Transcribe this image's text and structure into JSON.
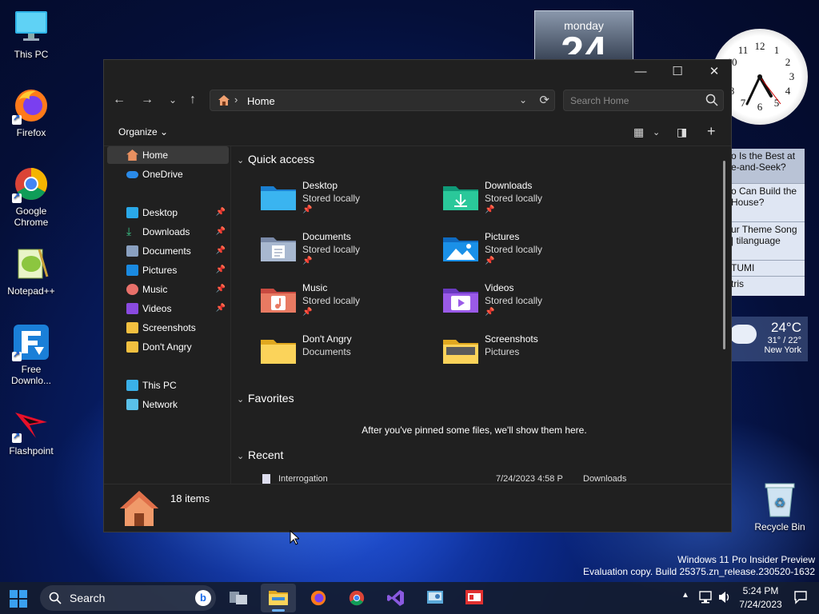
{
  "desktop": {
    "icons": [
      {
        "label": "This PC"
      },
      {
        "label": "Firefox"
      },
      {
        "label": "Google Chrome"
      },
      {
        "label": "Notepad++"
      },
      {
        "label": "Free Downlo..."
      },
      {
        "label": "Flashpoint"
      }
    ],
    "recycle_bin": "Recycle Bin",
    "watermark_line1": "Windows 11 Pro Insider Preview",
    "watermark_line2": "Evaluation copy. Build 25375.zn_release.230520-1632"
  },
  "gadgets": {
    "calendar_day": "monday",
    "calendar_num": "24",
    "rss": [
      "o Is the Best at e-and-Seek?",
      "o Can Build the House?",
      "ur Theme Song | tilanguage",
      "TUMI",
      "tris"
    ],
    "weather_temp": "24°C",
    "weather_range": "31° / 22°",
    "weather_city": "New York"
  },
  "explorer": {
    "address_path": "Home",
    "search_placeholder": "Search Home",
    "organize_label": "Organize",
    "sidebar": [
      {
        "label": "Home"
      },
      {
        "label": "OneDrive"
      },
      {
        "label": "Desktop"
      },
      {
        "label": "Downloads"
      },
      {
        "label": "Documents"
      },
      {
        "label": "Pictures"
      },
      {
        "label": "Music"
      },
      {
        "label": "Videos"
      },
      {
        "label": "Screenshots"
      },
      {
        "label": "Don't Angry"
      },
      {
        "label": "This PC"
      },
      {
        "label": "Network"
      }
    ],
    "quick_access_title": "Quick access",
    "quick_access": [
      {
        "name": "Desktop",
        "sub": "Stored locally"
      },
      {
        "name": "Downloads",
        "sub": "Stored locally"
      },
      {
        "name": "Documents",
        "sub": "Stored locally"
      },
      {
        "name": "Pictures",
        "sub": "Stored locally"
      },
      {
        "name": "Music",
        "sub": "Stored locally"
      },
      {
        "name": "Videos",
        "sub": "Stored locally"
      },
      {
        "name": "Don't Angry",
        "sub": "Documents"
      },
      {
        "name": "Screenshots",
        "sub": "Pictures"
      }
    ],
    "favorites_title": "Favorites",
    "favorites_empty": "After you've pinned some files, we'll show them here.",
    "recent_title": "Recent",
    "recent_row": {
      "name": "Interrogation",
      "date": "7/24/2023 4:58 P",
      "location": "Downloads"
    },
    "status_count": "18 items"
  },
  "taskbar": {
    "search_label": "Search",
    "time": "5:24 PM",
    "date": "7/24/2023"
  },
  "colors": {
    "accent": "#6ab0ff",
    "window_bg": "#202020"
  }
}
